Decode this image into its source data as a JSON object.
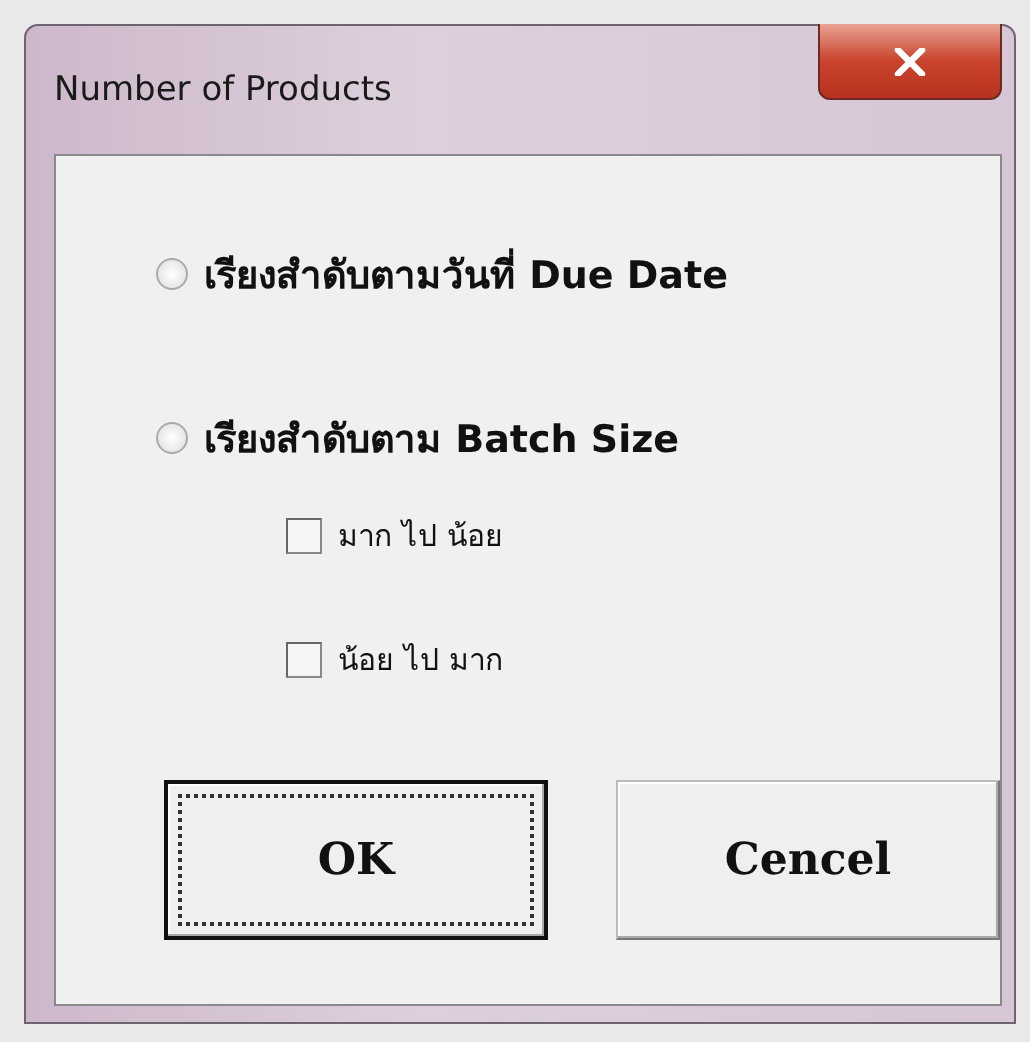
{
  "window": {
    "title": "Number of Products"
  },
  "sort_options": [
    {
      "label": "เรียงสำดับตามวันที่ Due Date",
      "selected": false
    },
    {
      "label": "เรียงสำดับตาม Batch Size",
      "selected": false
    }
  ],
  "order_options": [
    {
      "label": "มาก ไป น้อย",
      "checked": false
    },
    {
      "label": "น้อย ไป มาก",
      "checked": false
    }
  ],
  "buttons": [
    {
      "label": "OK",
      "focused": true
    },
    {
      "label": "Cencel",
      "focused": false
    }
  ]
}
